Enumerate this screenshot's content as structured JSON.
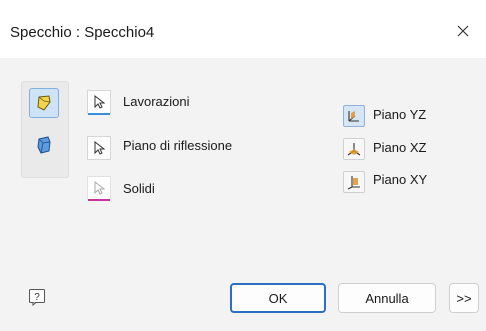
{
  "dialog": {
    "title": "Specchio : Specchio4",
    "close_icon": "close-icon"
  },
  "modes": [
    {
      "icon": "mirror-features-icon",
      "active": true
    },
    {
      "icon": "mirror-solids-icon",
      "active": false
    }
  ],
  "selectors": {
    "features_label": "Lavorazioni",
    "plane_label": "Piano di riflessione",
    "solids_label": "Solidi",
    "features_underline_color": "#3a8fd9",
    "solids_underline_color": "#c2369c"
  },
  "planes": [
    {
      "label": "Piano YZ",
      "icon": "plane-yz-icon",
      "active": true
    },
    {
      "label": "Piano XZ",
      "icon": "plane-xz-icon",
      "active": false
    },
    {
      "label": "Piano XY",
      "icon": "plane-xy-icon",
      "active": false
    }
  ],
  "footer": {
    "ok_label": "OK",
    "cancel_label": "Annulla",
    "more_label": ">>",
    "help_icon": "help-icon"
  },
  "colors": {
    "accent": "#2b6fc4",
    "icon_orange": "#e3922b",
    "icon_blue": "#3f7cc4"
  }
}
